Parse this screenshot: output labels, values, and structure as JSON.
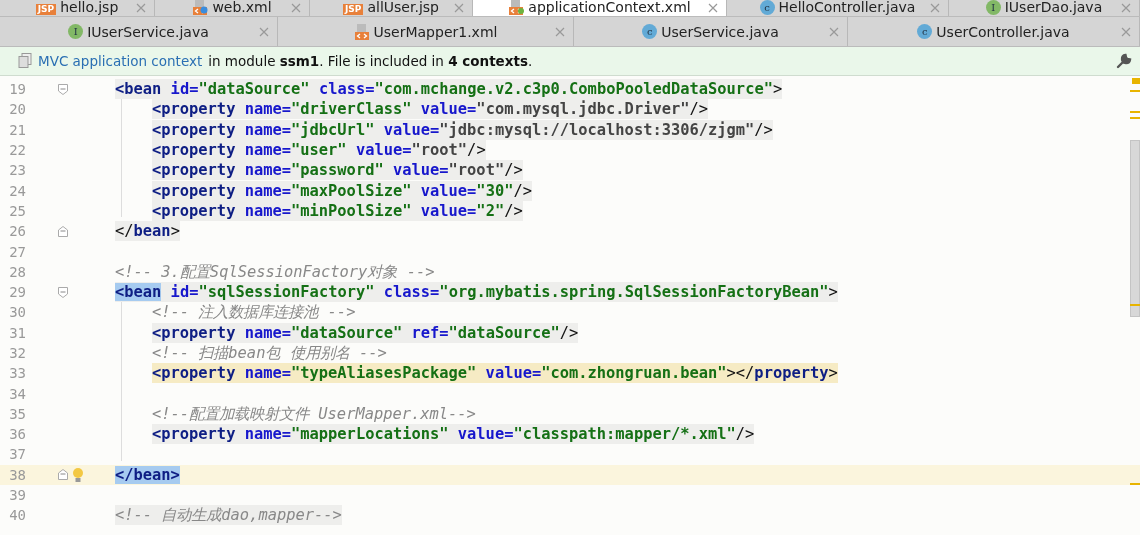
{
  "tab_rows": [
    [
      {
        "label": "hello.jsp",
        "selected": false,
        "kind": "jsp",
        "icon_text": "JSP"
      },
      {
        "label": "web.xml",
        "selected": false,
        "kind": "webxml"
      },
      {
        "label": "allUser.jsp",
        "selected": false,
        "kind": "jsp",
        "icon_text": "JSP"
      },
      {
        "label": "applicationContext.xml",
        "selected": true,
        "kind": "springxml"
      },
      {
        "label": "HelloController.java",
        "selected": false,
        "kind": "class",
        "icon_text": "c"
      },
      {
        "label": "IUserDao.java",
        "selected": false,
        "kind": "interface",
        "icon_text": "I"
      }
    ],
    [
      {
        "label": "IUserService.java",
        "selected": false,
        "kind": "interface",
        "icon_text": "I"
      },
      {
        "label": "UserMapper1.xml",
        "selected": false,
        "kind": "xml"
      },
      {
        "label": "UserService.java",
        "selected": false,
        "kind": "class",
        "icon_text": "c"
      },
      {
        "label": "UserController.java",
        "selected": false,
        "kind": "class",
        "icon_text": "c"
      }
    ]
  ],
  "info_bar": {
    "link": "MVC application context",
    "message": " in module **ssm1**. File is included in **4 contexts**."
  },
  "lines": [
    {
      "number": "19",
      "fold_marker": true,
      "kind": "shaded",
      "current": false,
      "tokens": [
        {
          "kind": "tag",
          "text": "<bean"
        },
        {
          "kind": "attr",
          "text": " id="
        },
        {
          "kind": "value",
          "text": "\"dataSource\""
        },
        {
          "kind": "attr",
          "text": " class="
        },
        {
          "kind": "value",
          "text": "\"com.mchange.v2.c3p0.ComboPooledDataSource\""
        },
        {
          "kind": "punct",
          "text": ">"
        }
      ],
      "children": [
        {
          "number": "20",
          "fold_marker": false,
          "kind": "shaded",
          "current": false,
          "tokens": [
            {
              "kind": "tag",
              "text": "<property"
            },
            {
              "kind": "attr",
              "text": " name="
            },
            {
              "kind": "value",
              "text": "\"driverClass\""
            },
            {
              "kind": "attr",
              "text": " value="
            },
            {
              "kind": "plainval",
              "text": "\"com.mysql.jdbc.Driver\""
            },
            {
              "kind": "punct",
              "text": "/>"
            }
          ]
        },
        {
          "number": "21",
          "fold_marker": false,
          "kind": "shaded",
          "current": false,
          "tokens": [
            {
              "kind": "tag",
              "text": "<property"
            },
            {
              "kind": "attr",
              "text": " name="
            },
            {
              "kind": "value",
              "text": "\"jdbcUrl\""
            },
            {
              "kind": "attr",
              "text": " value="
            },
            {
              "kind": "plainval",
              "text": "\"jdbc:mysql://localhost:3306/zjgm\""
            },
            {
              "kind": "punct",
              "text": "/>"
            }
          ]
        },
        {
          "number": "22",
          "fold_marker": false,
          "kind": "shaded",
          "current": false,
          "tokens": [
            {
              "kind": "tag",
              "text": "<property"
            },
            {
              "kind": "attr",
              "text": " name="
            },
            {
              "kind": "value",
              "text": "\"user\""
            },
            {
              "kind": "attr",
              "text": " value="
            },
            {
              "kind": "plainval",
              "text": "\"root\""
            },
            {
              "kind": "punct",
              "text": "/>"
            }
          ]
        },
        {
          "number": "23",
          "fold_marker": false,
          "kind": "shaded",
          "current": false,
          "tokens": [
            {
              "kind": "tag",
              "text": "<property"
            },
            {
              "kind": "attr",
              "text": " name="
            },
            {
              "kind": "value",
              "text": "\"password\""
            },
            {
              "kind": "attr",
              "text": " value="
            },
            {
              "kind": "plainval",
              "text": "\"root\""
            },
            {
              "kind": "punct",
              "text": "/>"
            }
          ]
        },
        {
          "number": "24",
          "fold_marker": false,
          "kind": "shaded",
          "current": false,
          "tokens": [
            {
              "kind": "tag",
              "text": "<property"
            },
            {
              "kind": "attr",
              "text": " name="
            },
            {
              "kind": "value",
              "text": "\"maxPoolSize\""
            },
            {
              "kind": "attr",
              "text": " value="
            },
            {
              "kind": "value",
              "text": "\"30\""
            },
            {
              "kind": "punct",
              "text": "/>"
            }
          ]
        },
        {
          "number": "25",
          "fold_marker": false,
          "kind": "shaded",
          "current": false,
          "tokens": [
            {
              "kind": "tag",
              "text": "<property"
            },
            {
              "kind": "attr",
              "text": " name="
            },
            {
              "kind": "value",
              "text": "\"minPoolSize\""
            },
            {
              "kind": "attr",
              "text": " value="
            },
            {
              "kind": "value",
              "text": "\"2\""
            },
            {
              "kind": "punct",
              "text": "/>"
            }
          ]
        }
      ]
    },
    {
      "number": "26",
      "fold_marker": true,
      "kind": "shaded",
      "current": false,
      "tokens": [
        {
          "kind": "punct",
          "text": "</"
        },
        {
          "kind": "tag",
          "text": "bean"
        },
        {
          "kind": "punct",
          "text": ">"
        }
      ]
    },
    {
      "number": "27",
      "fold_marker": false,
      "current": false
    },
    {
      "number": "28",
      "fold_marker": false,
      "kind": "plain",
      "current": false,
      "tokens": [
        {
          "kind": "comment",
          "text": "<!-- 3.配置SqlSessionFactory对象 -->"
        }
      ]
    },
    {
      "number": "29",
      "fold_marker": true,
      "kind": "shaded",
      "current": false,
      "tokens": [
        {
          "kind": "tag_sel",
          "text": "<bean"
        },
        {
          "kind": "attr",
          "text": " id="
        },
        {
          "kind": "value",
          "text": "\"sqlSessionFactory\""
        },
        {
          "kind": "attr",
          "text": " class="
        },
        {
          "kind": "value",
          "text": "\"org.mybatis.spring.SqlSessionFactoryBean\""
        },
        {
          "kind": "punct",
          "text": ">"
        }
      ],
      "children": [
        {
          "number": "30",
          "fold_marker": false,
          "kind": "plain",
          "current": false,
          "tokens": [
            {
              "kind": "comment",
              "text": "<!-- 注入数据库连接池 -->"
            }
          ]
        },
        {
          "number": "31",
          "fold_marker": false,
          "kind": "shaded",
          "current": false,
          "tokens": [
            {
              "kind": "tag",
              "text": "<property"
            },
            {
              "kind": "attr",
              "text": " name="
            },
            {
              "kind": "value",
              "text": "\"dataSource\""
            },
            {
              "kind": "attr",
              "text": " ref="
            },
            {
              "kind": "value",
              "text": "\"dataSource\""
            },
            {
              "kind": "punct",
              "text": "/>"
            }
          ]
        },
        {
          "number": "32",
          "fold_marker": false,
          "kind": "plain",
          "current": false,
          "tokens": [
            {
              "kind": "comment",
              "text": "<!-- 扫描bean包 使用别名 -->"
            }
          ]
        },
        {
          "number": "33",
          "fold_marker": false,
          "kind": "warning",
          "current": false,
          "tokens": [
            {
              "kind": "tag",
              "text": "<property"
            },
            {
              "kind": "attr",
              "text": " name="
            },
            {
              "kind": "value",
              "text": "\"typeAliasesPackage\""
            },
            {
              "kind": "attr",
              "text": " value="
            },
            {
              "kind": "value",
              "text": "\"com.zhongruan.bean\""
            },
            {
              "kind": "punct",
              "text": "></"
            },
            {
              "kind": "tag",
              "text": "property"
            },
            {
              "kind": "punct",
              "text": ">"
            }
          ]
        },
        {
          "number": "34",
          "fold_marker": false,
          "current": false
        },
        {
          "number": "35",
          "fold_marker": false,
          "kind": "plain",
          "current": false,
          "tokens": [
            {
              "kind": "comment",
              "text": "<!--配置加载映射文件 UserMapper.xml-->"
            }
          ]
        },
        {
          "number": "36",
          "fold_marker": false,
          "kind": "shaded",
          "current": false,
          "tokens": [
            {
              "kind": "tag",
              "text": "<property"
            },
            {
              "kind": "attr",
              "text": " name="
            },
            {
              "kind": "value",
              "text": "\"mapperLocations\""
            },
            {
              "kind": "attr",
              "text": " value="
            },
            {
              "kind": "value",
              "text": "\"classpath:mapper/*.xml\""
            },
            {
              "kind": "punct",
              "text": "/>"
            }
          ]
        },
        {
          "number": "37",
          "fold_marker": false,
          "current": false
        }
      ]
    },
    {
      "number": "38",
      "fold_marker": true,
      "bulb": true,
      "kind": "plain",
      "current": true,
      "tokens": [
        {
          "kind": "tag_sel",
          "text": "</bean>"
        }
      ]
    },
    {
      "number": "39",
      "fold_marker": false,
      "current": false
    },
    {
      "number": "40",
      "fold_marker": false,
      "kind": "shaded",
      "current": false,
      "tokens": [
        {
          "kind": "comment",
          "text": "<!-- 自动生成dao,mapper-->"
        }
      ]
    }
  ]
}
